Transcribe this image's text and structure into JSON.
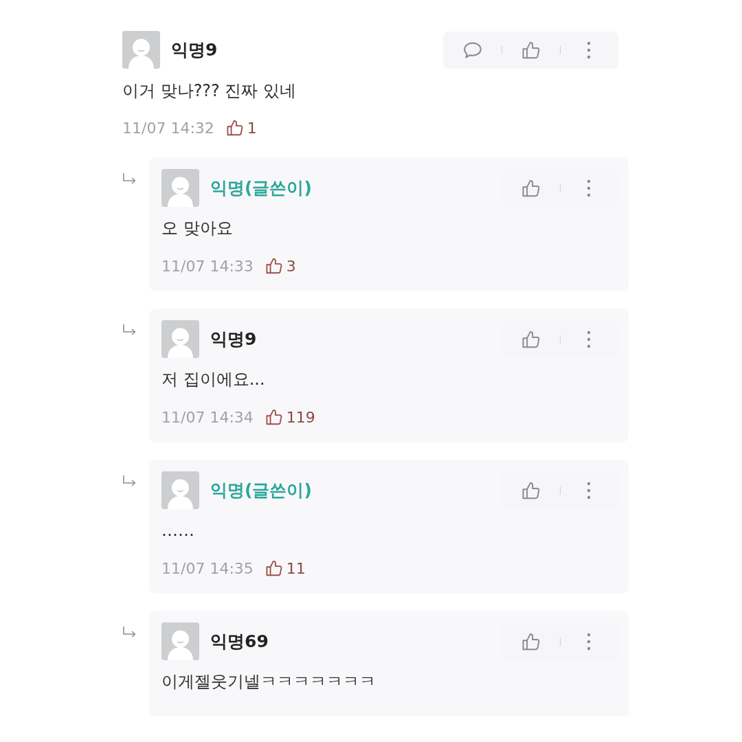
{
  "comments": [
    {
      "author": "익명9",
      "is_author": false,
      "text": "이거 맞나??? 진짜 있네",
      "time": "11/07 14:32",
      "likes": "1",
      "replies": [
        {
          "author": "익명(글쓴이)",
          "is_author": true,
          "text": "오 맞아요",
          "time": "11/07 14:33",
          "likes": "3"
        },
        {
          "author": "익명9",
          "is_author": false,
          "text": "저 집이에요...",
          "time": "11/07 14:34",
          "likes": "119"
        },
        {
          "author": "익명(글쓴이)",
          "is_author": true,
          "text": "……",
          "time": "11/07 14:35",
          "likes": "11"
        },
        {
          "author": "익명69",
          "is_author": false,
          "text": "이게젤웃기넬ㅋㅋㅋㅋㅋㅋㅋ"
        }
      ]
    }
  ]
}
